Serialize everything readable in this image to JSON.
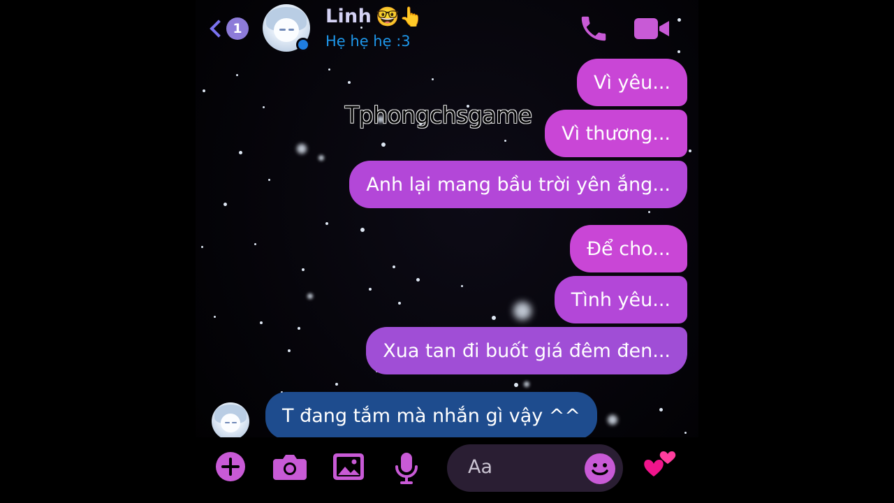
{
  "header": {
    "back_badge": "1",
    "contact_name": "Linh",
    "contact_emoji": "🤓👆",
    "status": "Hẹ hẹ hẹ :3",
    "call_icon": "phone-icon",
    "video_icon": "video-camera-icon"
  },
  "watermark": "Tphongchsgame",
  "messages": {
    "outgoing": [
      "Vì yêu...",
      "Vì thương...",
      "Anh lại mang bầu trời yên ắng...",
      "Để cho...",
      "Tình yêu...",
      "Xua tan đi buốt giá đêm đen..."
    ],
    "incoming": "T đang tắm mà nhắn gì vậy ^^"
  },
  "composer": {
    "placeholder": "Aa",
    "tools": [
      "plus-icon",
      "camera-icon",
      "image-icon",
      "microphone-icon"
    ],
    "emoji_icon": "smiley-icon",
    "like_icon": "hearts-icon"
  },
  "colors": {
    "accent": "#c74bd8",
    "incoming_bubble": "#1e4c8e",
    "status_text": "#1e97ea",
    "back_accent": "#7a72ef"
  }
}
